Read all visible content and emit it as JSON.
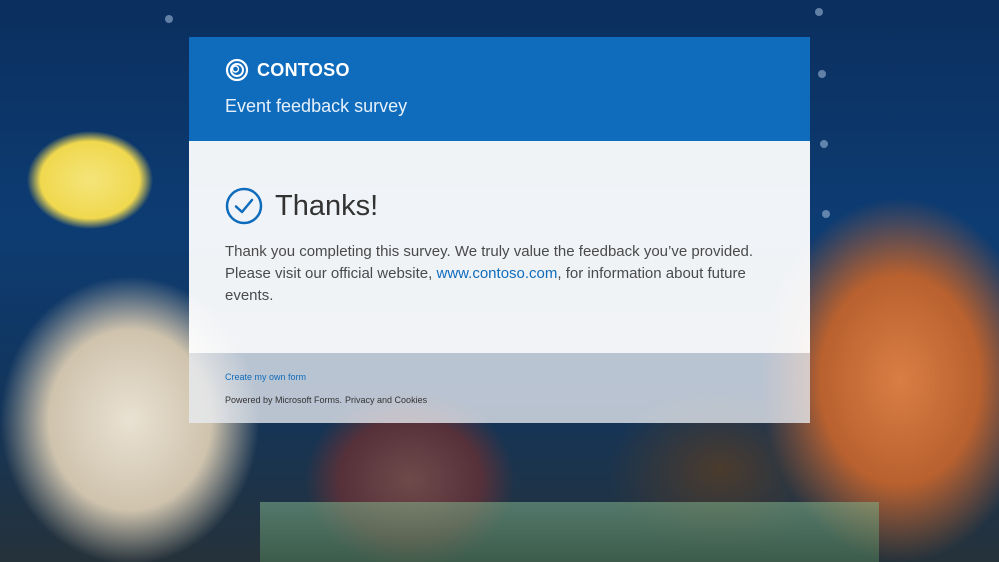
{
  "brand": {
    "name": "CONTOSO",
    "logo_icon": "contoso-ring-icon",
    "accent": "#0f6cbd"
  },
  "survey": {
    "title": "Event feedback survey"
  },
  "confirmation": {
    "check_icon": "check-circle-icon",
    "heading": "Thanks!",
    "message_before": "Thank you completing this survey. We truly value the feedback you’ve provided. Please visit our official website, ",
    "link_text": "www.contoso.com",
    "message_after": ", for information about future events."
  },
  "footer": {
    "create_link": "Create my own form",
    "powered_by": "Powered by Microsoft Forms.",
    "privacy_link": "Privacy and Cookies"
  }
}
